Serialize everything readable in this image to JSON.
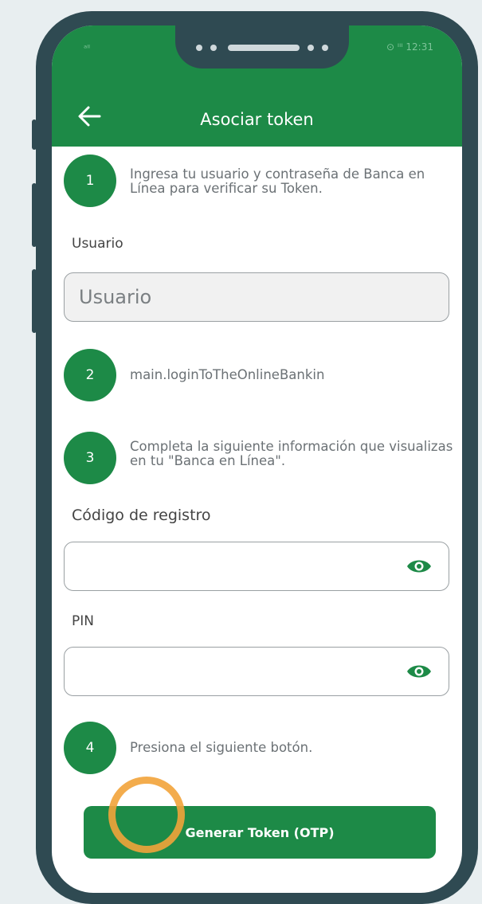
{
  "status": {
    "left": "ᵃˡˡ",
    "right": "⊙ ᴵᴵᴵ 12:31"
  },
  "header": {
    "title": "Asociar token"
  },
  "steps": [
    {
      "number": "1",
      "text": "Ingresa tu usuario y contraseña de Banca en Línea para verificar su Token."
    },
    {
      "number": "2",
      "text": "main.loginToTheOnlineBankin"
    },
    {
      "number": "3",
      "text": "Completa la siguiente información que visualizas en tu \"Banca en Línea\"."
    },
    {
      "number": "4",
      "text": "Presiona el siguiente botón."
    }
  ],
  "form": {
    "usuario_label": "Usuario",
    "usuario_placeholder": "Usuario",
    "codigo_label": "Código de registro",
    "pin_label": "PIN"
  },
  "button": {
    "label": "Generar Token (OTP)"
  },
  "colors": {
    "primary": "#1d8a47",
    "frame": "#2f4a52",
    "highlight": "#f2a33a"
  },
  "icons": [
    "back-arrow-icon",
    "eye-icon"
  ]
}
